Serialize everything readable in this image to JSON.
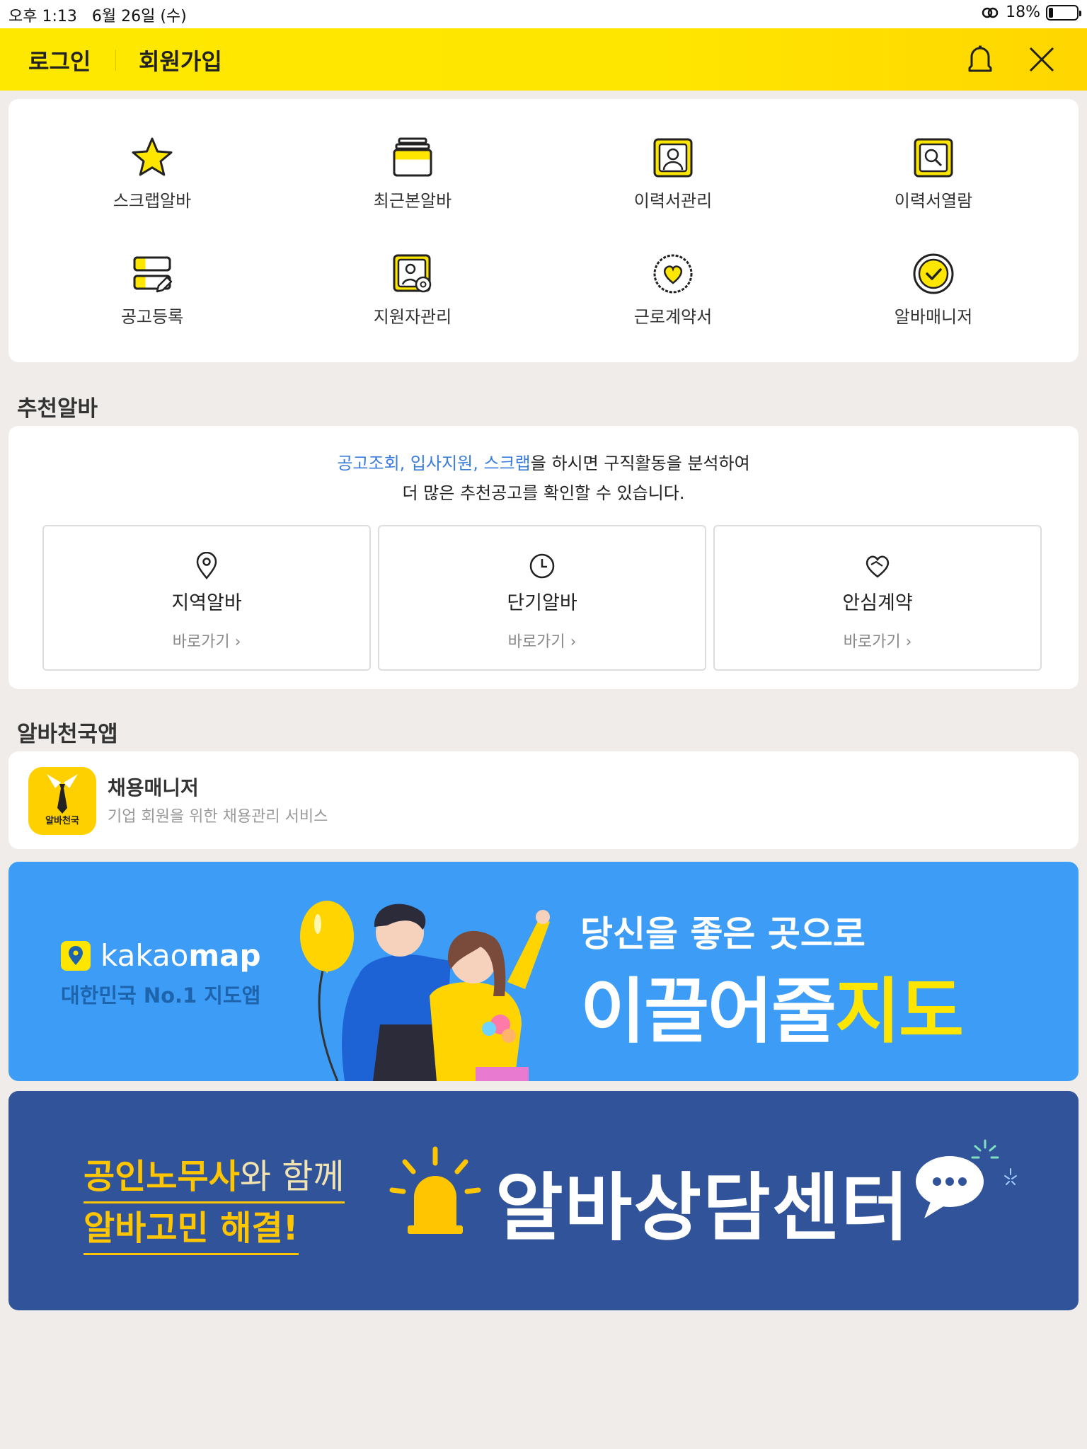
{
  "status_bar": {
    "time": "오후 1:13",
    "date": "6월 26일 (수)",
    "battery": "18%"
  },
  "header": {
    "login": "로그인",
    "join": "회원가입",
    "bell_icon": "bell-icon",
    "close_icon": "close-icon"
  },
  "menu": {
    "items": [
      {
        "label": "스크랩알바",
        "icon": "star-icon"
      },
      {
        "label": "최근본알바",
        "icon": "stack-icon"
      },
      {
        "label": "이력서관리",
        "icon": "resume-person-icon"
      },
      {
        "label": "이력서열람",
        "icon": "resume-search-icon"
      },
      {
        "label": "공고등록",
        "icon": "post-edit-icon"
      },
      {
        "label": "지원자관리",
        "icon": "applicant-gear-icon"
      },
      {
        "label": "근로계약서",
        "icon": "contract-heart-icon"
      },
      {
        "label": "알바매니저",
        "icon": "check-circle-icon"
      }
    ]
  },
  "recommend": {
    "title": "추천알바",
    "highlight": "공고조회, 입사지원, 스크랩",
    "text1_rest": "을 하시면 구직활동을 분석하여",
    "text2": "더 많은 추천공고를 확인할 수 있습니다.",
    "boxes": [
      {
        "title": "지역알바",
        "go": "바로가기",
        "icon": "location-pin-icon"
      },
      {
        "title": "단기알바",
        "go": "바로가기",
        "icon": "clock-icon"
      },
      {
        "title": "안심계약",
        "go": "바로가기",
        "icon": "handshake-heart-icon"
      }
    ]
  },
  "apps": {
    "title": "알바천국앱",
    "app_icon_text": "알바천국",
    "app_name": "채용매니저",
    "app_desc": "기업 회원을 위한 채용관리 서비스"
  },
  "banner_kakao": {
    "logo_kakao": "kakao",
    "logo_map": "map",
    "sub": "대한민국 No.1 지도앱",
    "line1": "당신을 좋은 곳으로",
    "line2_white": "이끌어줄",
    "line2_yellow": "지도"
  },
  "banner_counsel": {
    "line1_bold": "공인노무사",
    "line1_rest": "와 함께",
    "line2": "알바고민 해결!",
    "title": "알바상담센터"
  }
}
